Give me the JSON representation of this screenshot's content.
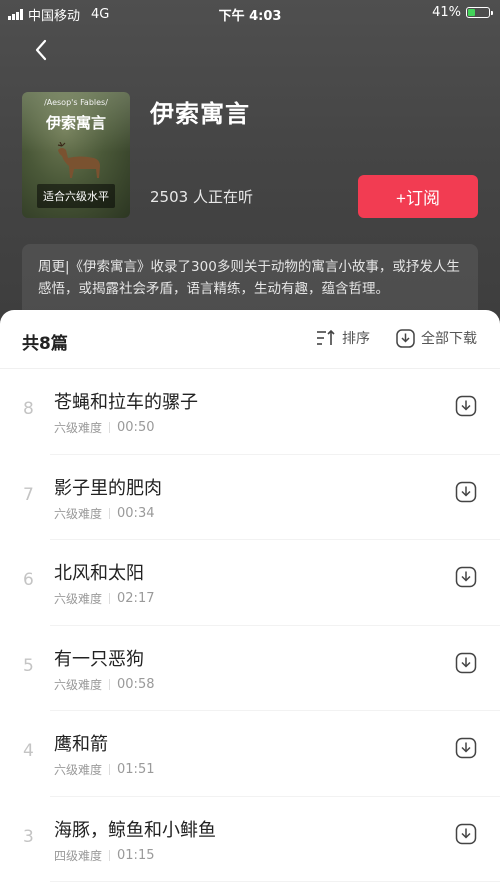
{
  "status_bar": {
    "carrier": "中国移动",
    "network": "4G",
    "time": "下午 4:03",
    "battery_text": "41%",
    "battery_level": 0.41
  },
  "header": {
    "back_icon": "chevron-left-icon"
  },
  "album": {
    "cover_english": "/Aesop's Fables/",
    "cover_chinese": "伊索寓言",
    "cover_badge": "适合六级水平",
    "title": "伊索寓言",
    "listeners": "2503 人正在听",
    "subscribe_label": "+订阅",
    "description": "周更|《伊索寓言》收录了300多则关于动物的寓言小故事，或抒发人生感悟，或揭露社会矛盾，语言精练，生动有趣，蕴含哲理。"
  },
  "colors": {
    "accent": "#f23c52",
    "header_bg": "#464646"
  },
  "list": {
    "count_label": "共8篇",
    "sort_label": "排序",
    "download_all_label": "全部下载",
    "items": [
      {
        "num": "8",
        "title": "苍蝇和拉车的骡子",
        "level": "六级难度",
        "duration": "00:50"
      },
      {
        "num": "7",
        "title": "影子里的肥肉",
        "level": "六级难度",
        "duration": "00:34"
      },
      {
        "num": "6",
        "title": "北风和太阳",
        "level": "六级难度",
        "duration": "02:17"
      },
      {
        "num": "5",
        "title": "有一只恶狗",
        "level": "六级难度",
        "duration": "00:58"
      },
      {
        "num": "4",
        "title": "鹰和箭",
        "level": "六级难度",
        "duration": "01:51"
      },
      {
        "num": "3",
        "title": "海豚，鲸鱼和小鲱鱼",
        "level": "四级难度",
        "duration": "01:15"
      }
    ]
  }
}
